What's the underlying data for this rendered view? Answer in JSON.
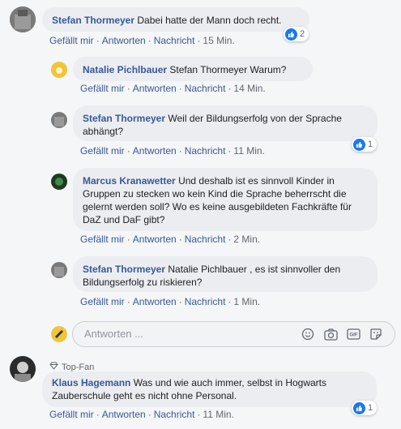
{
  "comments": [
    {
      "author": "Stefan Thormeyer",
      "text": "Dabei hatte der Mann doch recht.",
      "time": "15 Min.",
      "reactions": "2"
    },
    {
      "author": "Natalie Pichlbauer",
      "text": "Stefan Thormeyer Warum?",
      "time": "14 Min."
    },
    {
      "author": "Stefan Thormeyer",
      "text": "Weil der Bildungserfolg von der Sprache abhängt?",
      "time": "11 Min.",
      "reactions": "1"
    },
    {
      "author": "Marcus Kranawetter",
      "text": "Und deshalb ist es sinnvoll Kinder in Gruppen zu stecken wo kein Kind die Sprache beherrscht die gelernt werden soll? Wo es keine ausgebildeten Fachkräfte für DaZ und DaF gibt?",
      "time": "2 Min."
    },
    {
      "author": "Stefan Thormeyer",
      "text": "Natalie Pichlbauer , es ist sinnvoller den Bildungserfolg zu riskieren?",
      "time": "1 Min."
    },
    {
      "author": "Klaus Hagemann",
      "text": "Was und wie auch immer, selbst in Hogwarts Zauberschule geht es nicht ohne Personal.",
      "time": "11 Min.",
      "reactions": "1",
      "badge": "Top-Fan"
    }
  ],
  "actions": {
    "like": "Gefällt mir",
    "reply": "Antworten",
    "message": "Nachricht",
    "dot": "·"
  },
  "reply_box": {
    "placeholder": "Antworten ..."
  },
  "colors": {
    "author": "#385898",
    "bubble": "#ebedf0",
    "like": "#1877f2"
  }
}
